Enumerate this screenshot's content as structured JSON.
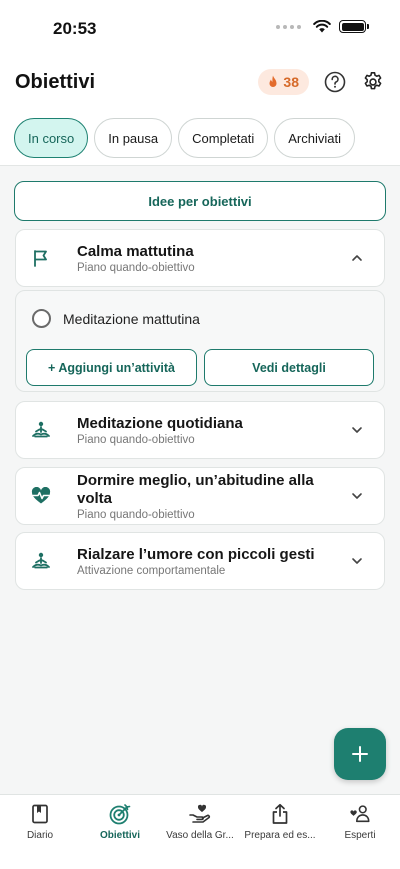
{
  "status_bar": {
    "time": "20:53"
  },
  "header": {
    "title": "Obiettivi",
    "streak_count": "38"
  },
  "tabs": [
    {
      "label": "In corso",
      "active": true
    },
    {
      "label": "In pausa",
      "active": false
    },
    {
      "label": "Completati",
      "active": false
    },
    {
      "label": "Archiviati",
      "active": false
    }
  ],
  "ideas_button": "Idee per obiettivi",
  "goals": [
    {
      "title": "Calma mattutina",
      "subtitle": "Piano quando-obiettivo",
      "icon": "flag-icon",
      "expanded": true
    },
    {
      "title": "Meditazione quotidiana",
      "subtitle": "Piano quando-obiettivo",
      "icon": "meditation-icon",
      "expanded": false
    },
    {
      "title": "Dormire meglio, un’abitudine alla volta",
      "subtitle": "Piano quando-obiettivo",
      "icon": "heartbeat-icon",
      "expanded": false
    },
    {
      "title": "Rialzare l’umore con piccoli gesti",
      "subtitle": "Attivazione comportamentale",
      "icon": "meditation-icon",
      "expanded": false
    }
  ],
  "expanded_goal": {
    "task": "Meditazione mattutina",
    "add_activity": "+ Aggiungi un’attività",
    "view_details": "Vedi dettagli"
  },
  "bottom_nav": [
    {
      "label": "Diario",
      "icon": "journal-icon",
      "active": false
    },
    {
      "label": "Obiettivi",
      "icon": "target-icon",
      "active": true
    },
    {
      "label": "Vaso della Gr...",
      "icon": "gratitude-jar-icon",
      "active": false
    },
    {
      "label": "Prepara ed es...",
      "icon": "share-icon",
      "active": false
    },
    {
      "label": "Esperti",
      "icon": "experts-icon",
      "active": false
    }
  ],
  "colors": {
    "accent": "#1e7f70",
    "accent_light": "#d3f5ef",
    "streak_bg": "#fde9df",
    "streak_text": "#d66a2a"
  }
}
